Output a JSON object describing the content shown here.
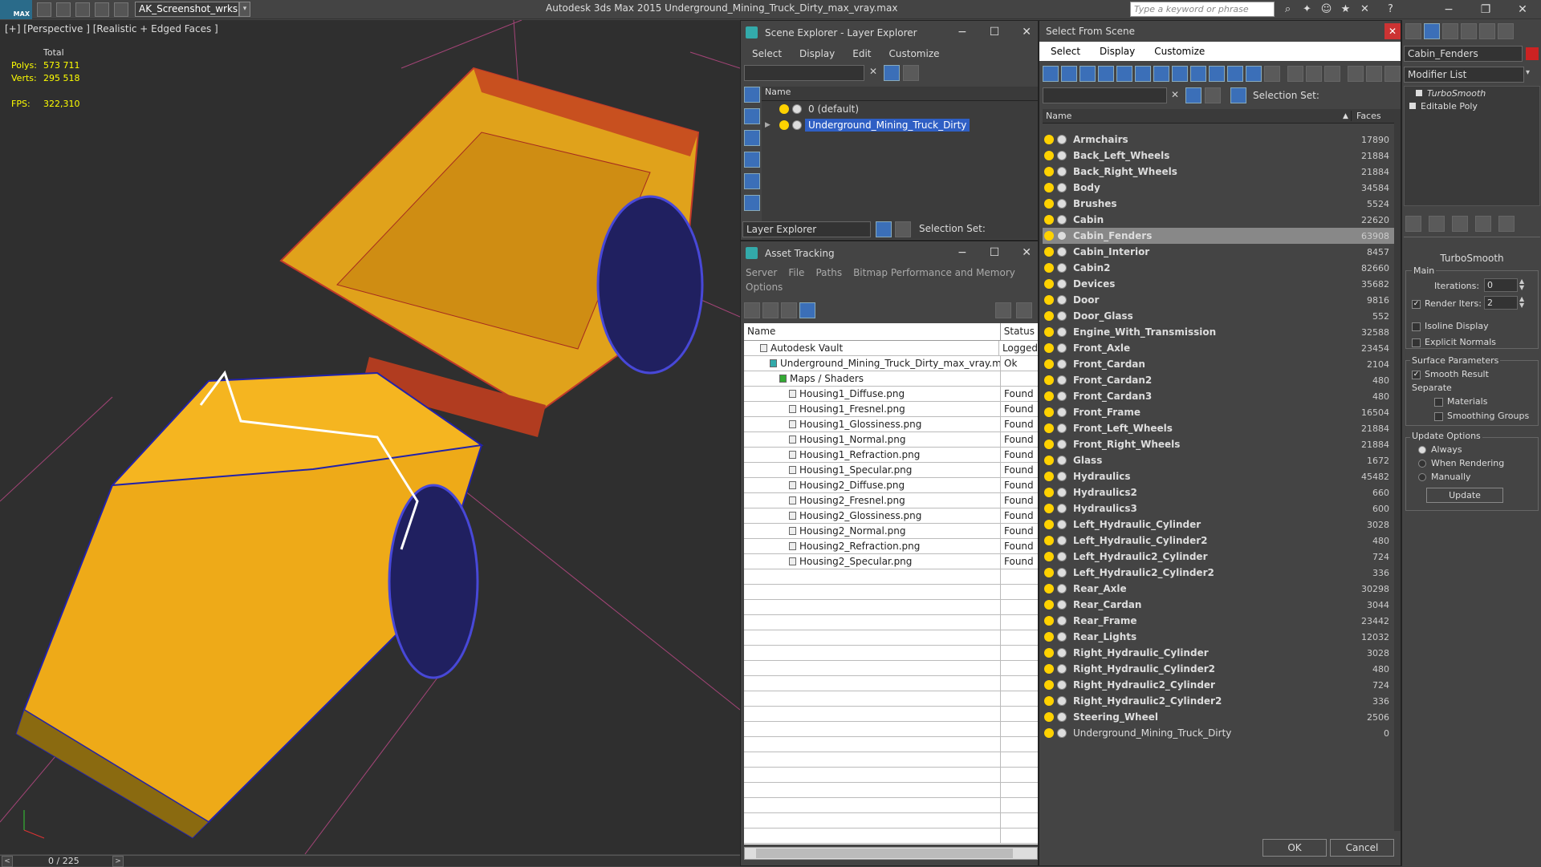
{
  "app": {
    "logo_text": "MAX",
    "workspace": "AK_Screenshot_wrksp",
    "title": "Autodesk 3ds Max  2015    Underground_Mining_Truck_Dirty_max_vray.max",
    "search_placeholder": "Type a keyword or phrase"
  },
  "viewport": {
    "label": "[+] [Perspective ] [Realistic + Edged Faces ]",
    "stats": {
      "total_label": "Total",
      "polys_label": "Polys:",
      "polys": "573 711",
      "verts_label": "Verts:",
      "verts": "295 518",
      "fps_label": "FPS:",
      "fps": "322,310"
    },
    "timeline_counter": "0 / 225"
  },
  "scene_explorer": {
    "title": "Scene Explorer - Layer Explorer",
    "menu": [
      "Select",
      "Display",
      "Edit",
      "Customize"
    ],
    "col_name": "Name",
    "layers": [
      "0 (default)",
      "Underground_Mining_Truck_Dirty"
    ],
    "footer_dropdown": "Layer Explorer",
    "selection_set_label": "Selection Set:"
  },
  "asset_tracking": {
    "title": "Asset Tracking",
    "menu1": [
      "Server",
      "File",
      "Paths",
      "Bitmap Performance and Memory"
    ],
    "menu2": [
      "Options"
    ],
    "col_name": "Name",
    "col_status": "Status",
    "rows": [
      {
        "name": "Autodesk Vault",
        "status": "Logged",
        "indent": 0
      },
      {
        "name": "Underground_Mining_Truck_Dirty_max_vray.max",
        "status": "Ok",
        "indent": 1
      },
      {
        "name": "Maps / Shaders",
        "status": "",
        "indent": 2
      },
      {
        "name": "Housing1_Diffuse.png",
        "status": "Found",
        "indent": 3
      },
      {
        "name": "Housing1_Fresnel.png",
        "status": "Found",
        "indent": 3
      },
      {
        "name": "Housing1_Glossiness.png",
        "status": "Found",
        "indent": 3
      },
      {
        "name": "Housing1_Normal.png",
        "status": "Found",
        "indent": 3
      },
      {
        "name": "Housing1_Refraction.png",
        "status": "Found",
        "indent": 3
      },
      {
        "name": "Housing1_Specular.png",
        "status": "Found",
        "indent": 3
      },
      {
        "name": "Housing2_Diffuse.png",
        "status": "Found",
        "indent": 3
      },
      {
        "name": "Housing2_Fresnel.png",
        "status": "Found",
        "indent": 3
      },
      {
        "name": "Housing2_Glossiness.png",
        "status": "Found",
        "indent": 3
      },
      {
        "name": "Housing2_Normal.png",
        "status": "Found",
        "indent": 3
      },
      {
        "name": "Housing2_Refraction.png",
        "status": "Found",
        "indent": 3
      },
      {
        "name": "Housing2_Specular.png",
        "status": "Found",
        "indent": 3
      }
    ]
  },
  "select_from_scene": {
    "title": "Select From Scene",
    "menu": [
      "Select",
      "Display",
      "Customize"
    ],
    "selection_set_label": "Selection Set:",
    "col_name": "Name",
    "col_faces": "Faces",
    "selected": "Cabin_Fenders",
    "rows": [
      {
        "name": "Armchairs",
        "faces": "17890"
      },
      {
        "name": "Back_Left_Wheels",
        "faces": "21884"
      },
      {
        "name": "Back_Right_Wheels",
        "faces": "21884"
      },
      {
        "name": "Body",
        "faces": "34584"
      },
      {
        "name": "Brushes",
        "faces": "5524"
      },
      {
        "name": "Cabin",
        "faces": "22620"
      },
      {
        "name": "Cabin_Fenders",
        "faces": "63908"
      },
      {
        "name": "Cabin_Interior",
        "faces": "8457"
      },
      {
        "name": "Cabin2",
        "faces": "82660"
      },
      {
        "name": "Devices",
        "faces": "35682"
      },
      {
        "name": "Door",
        "faces": "9816"
      },
      {
        "name": "Door_Glass",
        "faces": "552"
      },
      {
        "name": "Engine_With_Transmission",
        "faces": "32588"
      },
      {
        "name": "Front_Axle",
        "faces": "23454"
      },
      {
        "name": "Front_Cardan",
        "faces": "2104"
      },
      {
        "name": "Front_Cardan2",
        "faces": "480"
      },
      {
        "name": "Front_Cardan3",
        "faces": "480"
      },
      {
        "name": "Front_Frame",
        "faces": "16504"
      },
      {
        "name": "Front_Left_Wheels",
        "faces": "21884"
      },
      {
        "name": "Front_Right_Wheels",
        "faces": "21884"
      },
      {
        "name": "Glass",
        "faces": "1672"
      },
      {
        "name": "Hydraulics",
        "faces": "45482"
      },
      {
        "name": "Hydraulics2",
        "faces": "660"
      },
      {
        "name": "Hydraulics3",
        "faces": "600"
      },
      {
        "name": "Left_Hydraulic_Cylinder",
        "faces": "3028"
      },
      {
        "name": "Left_Hydraulic_Cylinder2",
        "faces": "480"
      },
      {
        "name": "Left_Hydraulic2_Cylinder",
        "faces": "724"
      },
      {
        "name": "Left_Hydraulic2_Cylinder2",
        "faces": "336"
      },
      {
        "name": "Rear_Axle",
        "faces": "30298"
      },
      {
        "name": "Rear_Cardan",
        "faces": "3044"
      },
      {
        "name": "Rear_Frame",
        "faces": "23442"
      },
      {
        "name": "Rear_Lights",
        "faces": "12032"
      },
      {
        "name": "Right_Hydraulic_Cylinder",
        "faces": "3028"
      },
      {
        "name": "Right_Hydraulic_Cylinder2",
        "faces": "480"
      },
      {
        "name": "Right_Hydraulic2_Cylinder",
        "faces": "724"
      },
      {
        "name": "Right_Hydraulic2_Cylinder2",
        "faces": "336"
      },
      {
        "name": "Steering_Wheel",
        "faces": "2506"
      },
      {
        "name": "Underground_Mining_Truck_Dirty",
        "faces": "0"
      }
    ],
    "ok_label": "OK",
    "cancel_label": "Cancel"
  },
  "modifier_panel": {
    "object_name": "Cabin_Fenders",
    "modifier_list_label": "Modifier List",
    "stack": [
      "TurboSmooth",
      "Editable Poly"
    ],
    "rollout_title": "TurboSmooth",
    "main_label": "Main",
    "iterations_label": "Iterations:",
    "iterations": "0",
    "render_iters_label": "Render Iters:",
    "render_iters": "2",
    "isoline_label": "Isoline Display",
    "explicit_normals_label": "Explicit Normals",
    "surface_params_label": "Surface Parameters",
    "smooth_result_label": "Smooth Result",
    "separate_label": "Separate",
    "materials_label": "Materials",
    "smoothing_groups_label": "Smoothing Groups",
    "update_options_label": "Update Options",
    "always_label": "Always",
    "when_rendering_label": "When Rendering",
    "manually_label": "Manually",
    "update_button": "Update"
  }
}
